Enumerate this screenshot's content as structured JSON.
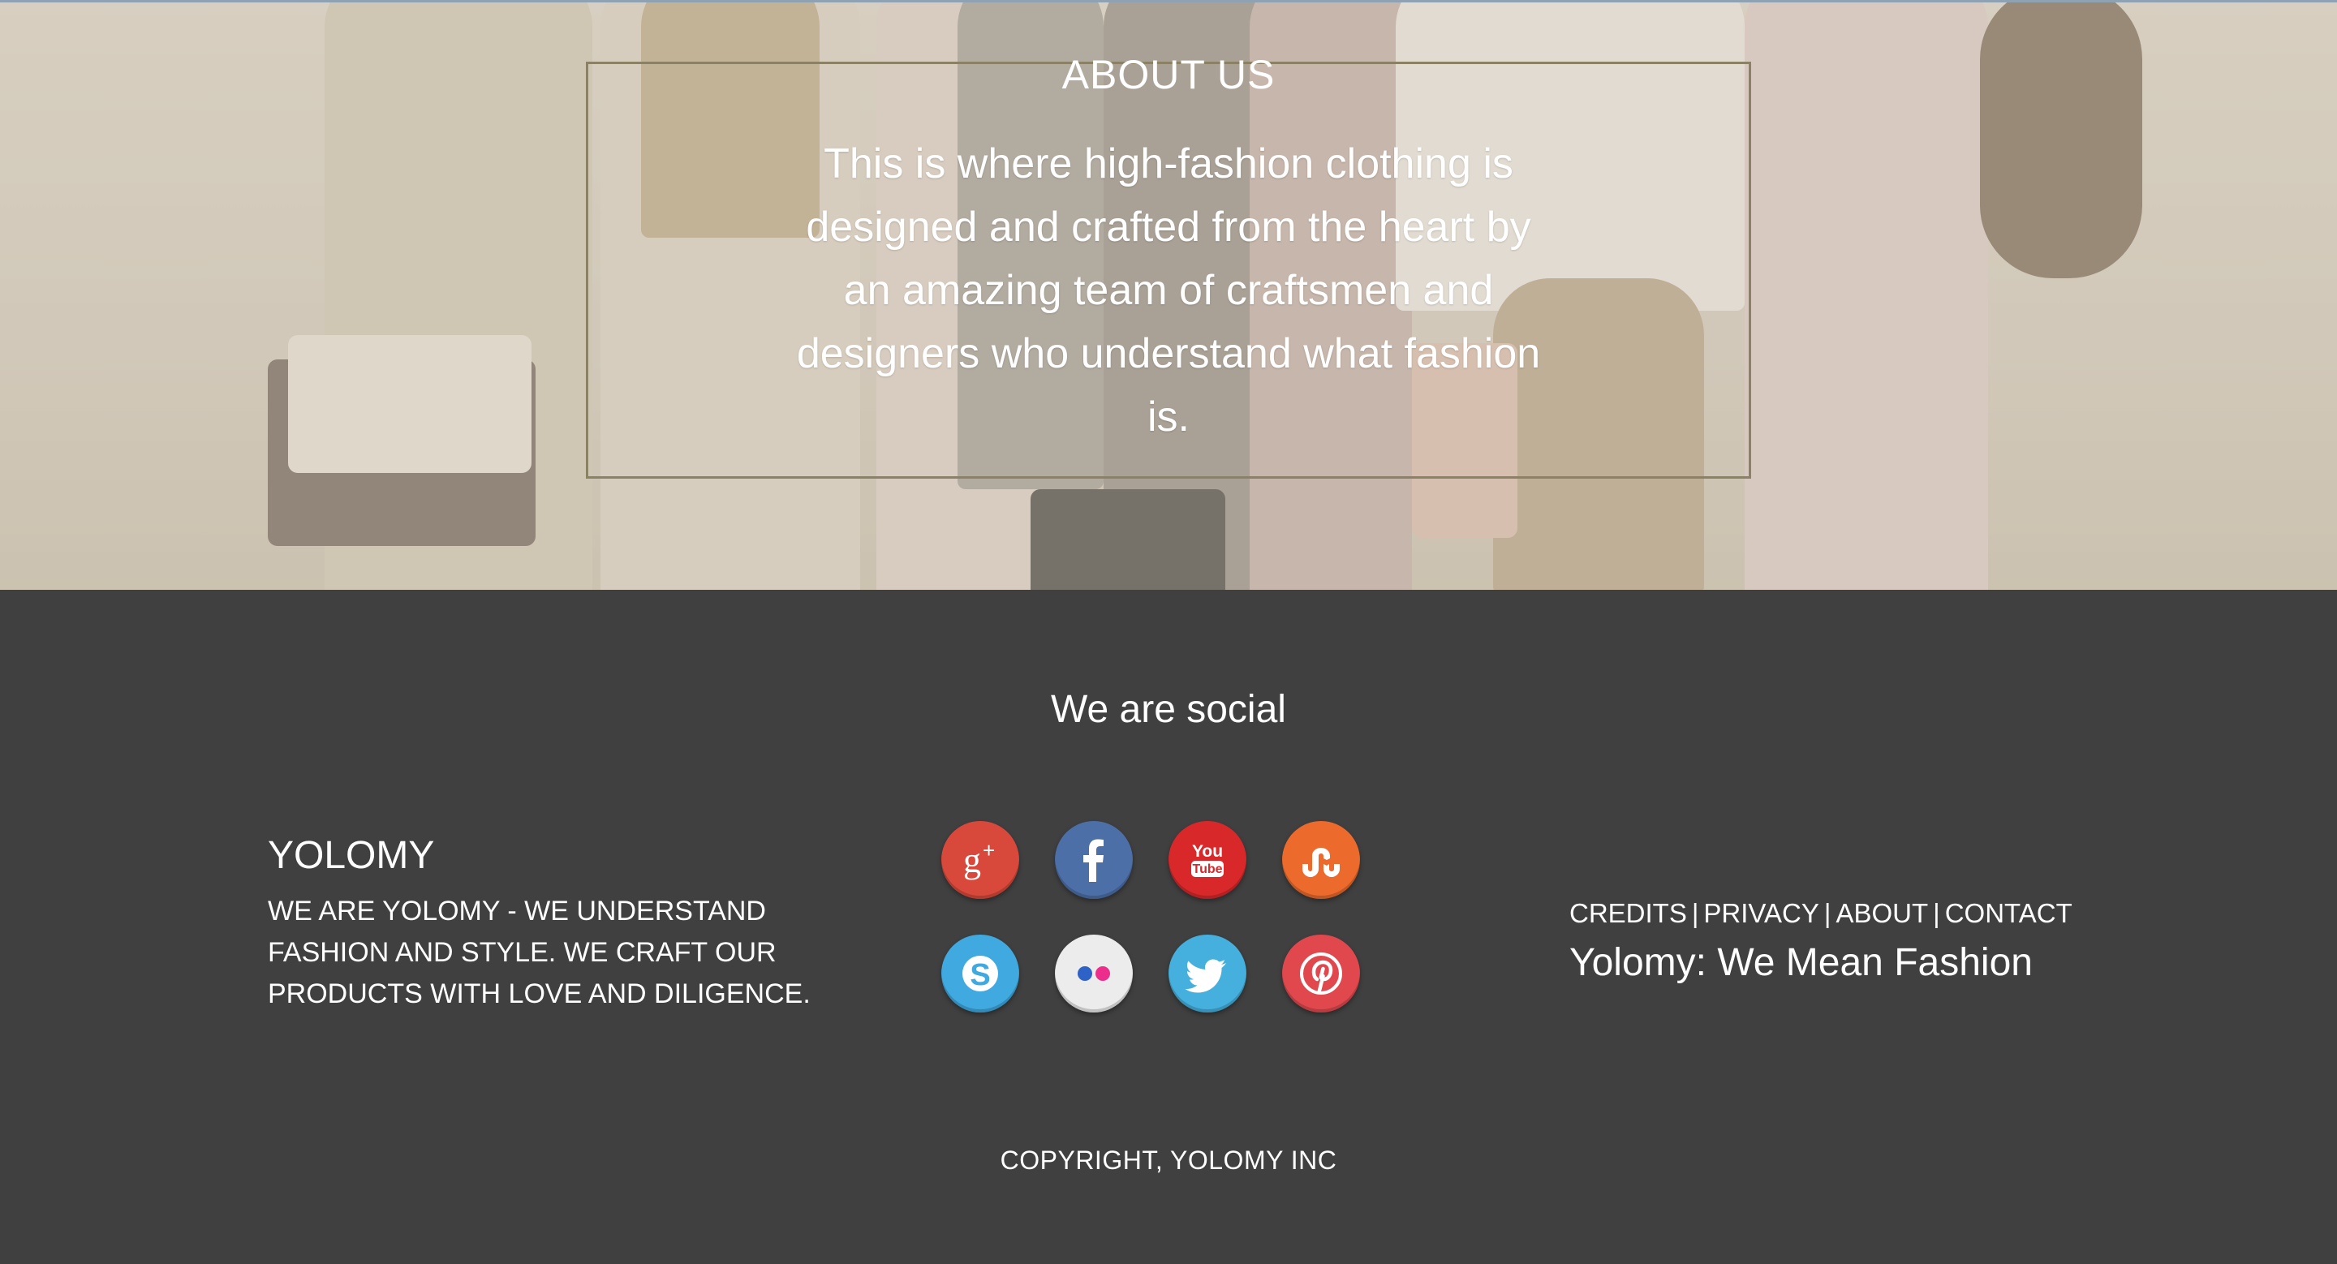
{
  "about": {
    "title": "ABOUT US",
    "text": "This is where high-fashion clothing is designed and crafted from the heart by an amazing team of craftsmen and designers who understand what fashion is."
  },
  "footer": {
    "social_heading": "We are social",
    "brand": {
      "name": "YOLOMY",
      "description": "WE ARE YOLOMY - WE UNDERSTAND FASHION AND STYLE. WE CRAFT OUR PRODUCTS WITH LOVE AND DILIGENCE."
    },
    "social_icons": [
      {
        "name": "google-plus-icon",
        "color": "#d9493b"
      },
      {
        "name": "facebook-icon",
        "color": "#4d6fa8"
      },
      {
        "name": "youtube-icon",
        "color": "#d8282a"
      },
      {
        "name": "stumbleupon-icon",
        "color": "#eb6a2c"
      },
      {
        "name": "skype-icon",
        "color": "#3fa9e0"
      },
      {
        "name": "flickr-icon",
        "color": "#ececec"
      },
      {
        "name": "twitter-icon",
        "color": "#45b0de"
      },
      {
        "name": "pinterest-icon",
        "color": "#e0484e"
      }
    ],
    "links": {
      "credits": "CREDITS",
      "privacy": "PRIVACY",
      "about": "ABOUT",
      "contact": "CONTACT",
      "separator": "|"
    },
    "tagline": "Yolomy: We Mean Fashion",
    "copyright": "COPYRIGHT, YOLOMY INC"
  }
}
